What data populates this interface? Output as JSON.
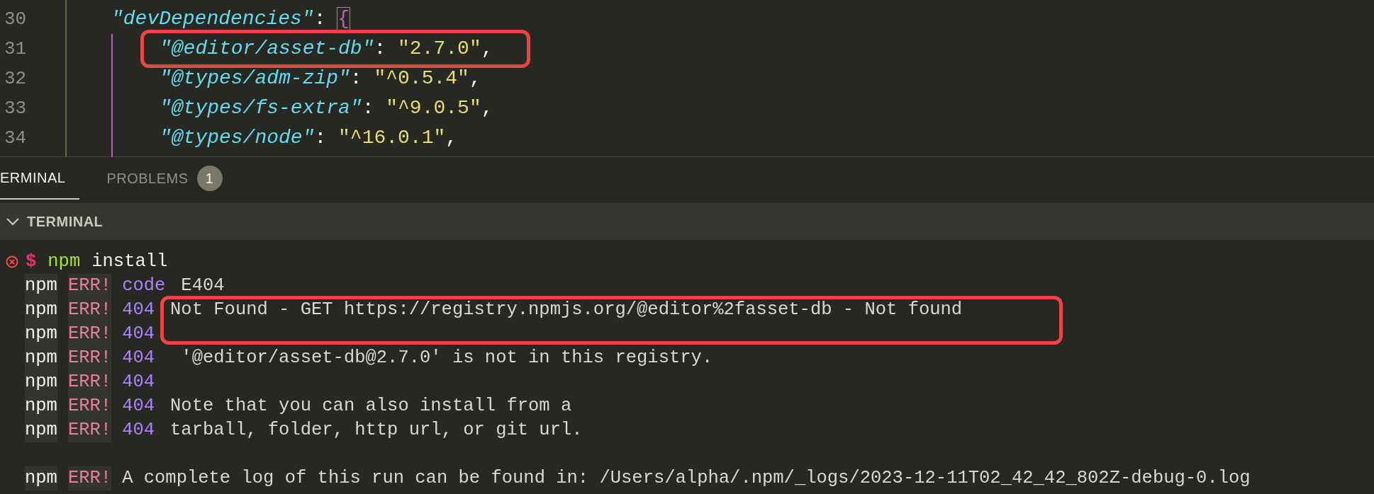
{
  "editor": {
    "lines": [
      {
        "number": "30",
        "highlighted": false,
        "tokens": [
          {
            "kind": "key",
            "text": "\"devDependencies\""
          },
          {
            "kind": "punct",
            "text": ": "
          },
          {
            "kind": "brace",
            "text": "{"
          }
        ],
        "children": [
          {
            "number": "31",
            "highlighted": true,
            "tokens": [
              {
                "kind": "key",
                "text": "\"@editor/asset-db\""
              },
              {
                "kind": "punct",
                "text": ": "
              },
              {
                "kind": "string",
                "text": "\"2.7.0\""
              },
              {
                "kind": "punct",
                "text": ","
              }
            ]
          },
          {
            "number": "32",
            "highlighted": false,
            "tokens": [
              {
                "kind": "key",
                "text": "\"@types/adm-zip\""
              },
              {
                "kind": "punct",
                "text": ": "
              },
              {
                "kind": "string",
                "text": "\"^0.5.4\""
              },
              {
                "kind": "punct",
                "text": ","
              }
            ]
          },
          {
            "number": "33",
            "highlighted": false,
            "tokens": [
              {
                "kind": "key",
                "text": "\"@types/fs-extra\""
              },
              {
                "kind": "punct",
                "text": ": "
              },
              {
                "kind": "string",
                "text": "\"^9.0.5\""
              },
              {
                "kind": "punct",
                "text": ","
              }
            ]
          },
          {
            "number": "34",
            "highlighted": false,
            "tokens": [
              {
                "kind": "key",
                "text": "\"@types/node\""
              },
              {
                "kind": "punct",
                "text": ": "
              },
              {
                "kind": "string",
                "text": "\"^16.0.1\""
              },
              {
                "kind": "punct",
                "text": ","
              }
            ]
          }
        ]
      }
    ]
  },
  "panel_tabs": [
    {
      "label": "ERMINAL",
      "selected": true
    },
    {
      "label": "PROBLEMS",
      "selected": false,
      "badge": "1"
    }
  ],
  "terminal": {
    "header": "TERMINAL",
    "lines": [
      {
        "kind": "prompt",
        "symbol": "$",
        "command": "npm",
        "args": "install"
      },
      {
        "kind": "error",
        "prefix": "npm",
        "tag": "ERR!",
        "code": "code",
        "message": "E404"
      },
      {
        "kind": "error",
        "prefix": "npm",
        "tag": "ERR!",
        "code": "404",
        "message": "Not Found - GET https://registry.npmjs.org/@editor%2fasset-db - Not found"
      },
      {
        "kind": "error",
        "prefix": "npm",
        "tag": "ERR!",
        "code": "404"
      },
      {
        "kind": "error",
        "prefix": "npm",
        "tag": "ERR!",
        "code": "404",
        "message": " '@editor/asset-db@2.7.0' is not in this registry."
      },
      {
        "kind": "error",
        "prefix": "npm",
        "tag": "ERR!",
        "code": "404"
      },
      {
        "kind": "error",
        "prefix": "npm",
        "tag": "ERR!",
        "code": "404",
        "message": "Note that you can also install from a"
      },
      {
        "kind": "error",
        "prefix": "npm",
        "tag": "ERR!",
        "code": "404",
        "message": "tarball, folder, http url, or git url."
      },
      {
        "kind": "blank"
      },
      {
        "kind": "error",
        "prefix": "npm",
        "tag": "ERR!",
        "message": "A complete log of this run can be found in: /Users/alpha/.npm/_logs/2023-12-11T02_42_42_802Z-debug-0.log"
      }
    ]
  }
}
